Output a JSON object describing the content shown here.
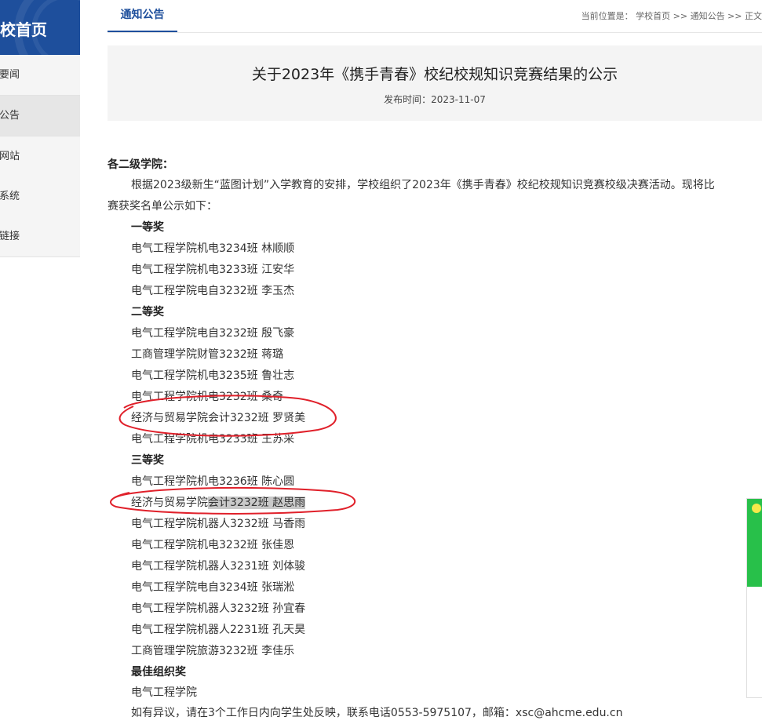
{
  "sidebar": {
    "title": "校首页",
    "items": [
      {
        "label": "校要闻"
      },
      {
        "label": "知公告"
      },
      {
        "label": "题网站"
      },
      {
        "label": "用系统"
      },
      {
        "label": "情链接"
      }
    ]
  },
  "tabs": {
    "active": "通知公告"
  },
  "breadcrumb": {
    "text": "当前位置是： 学校首页 >> 通知公告 >> 正文"
  },
  "article": {
    "title": "关于2023年《携手青春》校纪校规知识竞赛结果的公示",
    "date": "发布时间：2023-11-07",
    "greeting": "各二级学院：",
    "intro_1": "根据2023级新生“蓝图计划”入学教育的安排，学校组织了2023年《携手青春》校纪校规知识竞赛校级决赛活动。现将比",
    "intro_2": "赛获奖名单公示如下：",
    "first_prize": "一等奖",
    "first": [
      "电气工程学院机电3234班 林顺顺",
      "电气工程学院机电3233班 江安华",
      "电气工程学院电自3232班 李玉杰"
    ],
    "second_prize": "二等奖",
    "second": [
      "电气工程学院电自3232班  殷飞豪",
      "工商管理学院财管3232班  蒋璐",
      "电气工程学院机电3235班  鲁壮志",
      "电气工程学院机电3232班  桑奇",
      "经济与贸易学院会计3232班 罗贤美",
      "电气工程学院机电3233班  王苏采"
    ],
    "third_prize": "三等奖",
    "third_a": "电气工程学院机电3236班  陈心圆",
    "third_b_pre": "经济与贸易学院",
    "third_b_hl": "会计3232班 赵思雨",
    "third_rest": [
      "电气工程学院机器人3232班 马香雨",
      "电气工程学院机电3232班  张佳恩",
      "电气工程学院机器人3231班 刘体骏",
      "电气工程学院电自3234班  张瑞淞",
      "电气工程学院机器人3232班 孙宜春",
      "电气工程学院机器人2231班 孔天昊",
      "工商管理学院旅游3232班  李佳乐"
    ],
    "org_prize": "最佳组织奖",
    "org": "电气工程学院",
    "contact": "如有异议，请在3个工作日内向学生处反映，联系电话0553-5975107，邮箱：xsc@ahcme.edu.cn"
  },
  "colors": {
    "brand": "#1e4f9c",
    "annotation": "#e0202a",
    "widget": "#28c04a"
  }
}
